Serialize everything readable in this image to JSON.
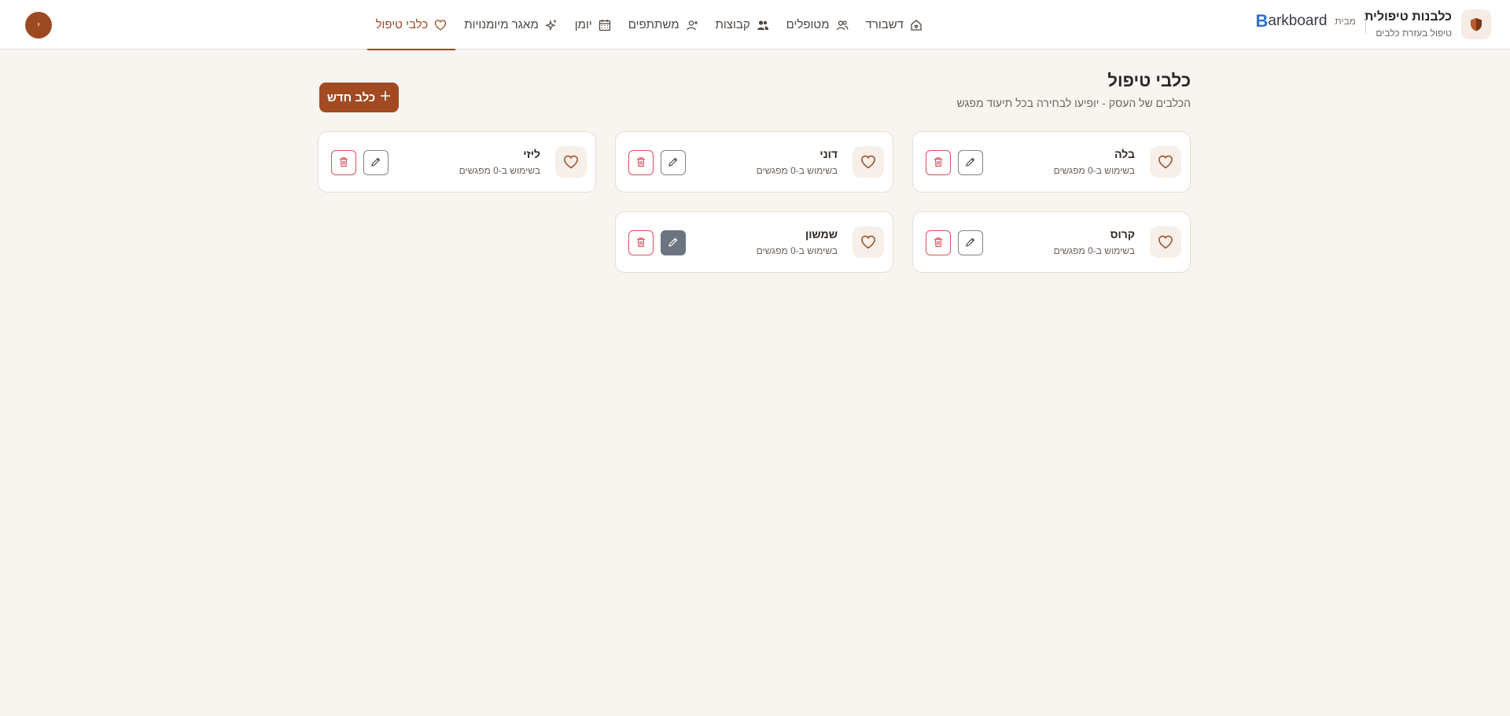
{
  "brand": {
    "title": "כלבנות טיפולית",
    "subtitle": "טיפול בעזרת כלבים",
    "powered_label": "מבית",
    "platform_b": "B",
    "platform_rest": "arkboard"
  },
  "nav": {
    "items": [
      {
        "label": "דשבורד",
        "icon": "home-heart-icon",
        "active": false
      },
      {
        "label": "מטופלים",
        "icon": "users-icon",
        "active": false
      },
      {
        "label": "קבוצות",
        "icon": "group-icon",
        "active": false
      },
      {
        "label": "משתתפים",
        "icon": "user-plus-icon",
        "active": false
      },
      {
        "label": "יומן",
        "icon": "calendar-icon",
        "active": false
      },
      {
        "label": "מאגר מיומנויות",
        "icon": "sparkles-icon",
        "active": false
      },
      {
        "label": "כלבי טיפול",
        "icon": "heart-icon",
        "active": true
      }
    ]
  },
  "user": {
    "avatar_initial": "י"
  },
  "page": {
    "title": "כלבי טיפול",
    "subtitle": "הכלבים של העסק - יופיעו לבחירה בכל תיעוד מפגש",
    "add_button": "כלב חדש"
  },
  "dogs": [
    {
      "name": "בלה",
      "usage": "בשימוש ב-0 מפגשים"
    },
    {
      "name": "דוני",
      "usage": "בשימוש ב-0 מפגשים"
    },
    {
      "name": "ליזי",
      "usage": "בשימוש ב-0 מפגשים"
    },
    {
      "name": "קרוס",
      "usage": "בשימוש ב-0 מפגשים"
    },
    {
      "name": "שמשון",
      "usage": "בשימוש ב-0 מפגשים"
    }
  ],
  "colors": {
    "accent": "#9c4a22",
    "background": "#f8f5f1",
    "danger": "#e0505f"
  }
}
